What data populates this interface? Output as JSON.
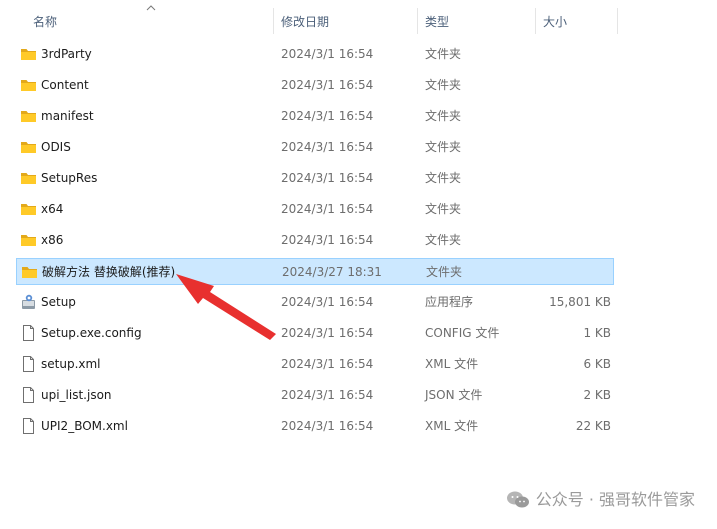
{
  "columns": {
    "name": "名称",
    "date": "修改日期",
    "type": "类型",
    "size": "大小"
  },
  "files": [
    {
      "name": "3rdParty",
      "date": "2024/3/1 16:54",
      "type": "文件夹",
      "size": "",
      "icon": "folder-icon"
    },
    {
      "name": "Content",
      "date": "2024/3/1 16:54",
      "type": "文件夹",
      "size": "",
      "icon": "folder-icon"
    },
    {
      "name": "manifest",
      "date": "2024/3/1 16:54",
      "type": "文件夹",
      "size": "",
      "icon": "folder-icon"
    },
    {
      "name": "ODIS",
      "date": "2024/3/1 16:54",
      "type": "文件夹",
      "size": "",
      "icon": "folder-icon"
    },
    {
      "name": "SetupRes",
      "date": "2024/3/1 16:54",
      "type": "文件夹",
      "size": "",
      "icon": "folder-icon"
    },
    {
      "name": "x64",
      "date": "2024/3/1 16:54",
      "type": "文件夹",
      "size": "",
      "icon": "folder-icon"
    },
    {
      "name": "x86",
      "date": "2024/3/1 16:54",
      "type": "文件夹",
      "size": "",
      "icon": "folder-icon"
    },
    {
      "name": "破解方法 替换破解(推荐)",
      "date": "2024/3/27 18:31",
      "type": "文件夹",
      "size": "",
      "icon": "folder-icon",
      "selected": true
    },
    {
      "name": "Setup",
      "date": "2024/3/1 16:54",
      "type": "应用程序",
      "size": "15,801 KB",
      "icon": "setup-app-icon"
    },
    {
      "name": "Setup.exe.config",
      "date": "2024/3/1 16:54",
      "type": "CONFIG 文件",
      "size": "1 KB",
      "icon": "file-icon"
    },
    {
      "name": "setup.xml",
      "date": "2024/3/1 16:54",
      "type": "XML 文件",
      "size": "6 KB",
      "icon": "file-icon"
    },
    {
      "name": "upi_list.json",
      "date": "2024/3/1 16:54",
      "type": "JSON 文件",
      "size": "2 KB",
      "icon": "file-icon"
    },
    {
      "name": "UPI2_BOM.xml",
      "date": "2024/3/1 16:54",
      "type": "XML 文件",
      "size": "22 KB",
      "icon": "file-icon"
    }
  ],
  "watermark": "公众号 · 强哥软件管家",
  "colors": {
    "selection_bg": "#cce8ff",
    "selection_border": "#99d1ff",
    "folder": "#ffca28",
    "arrow": "#e8302f"
  }
}
